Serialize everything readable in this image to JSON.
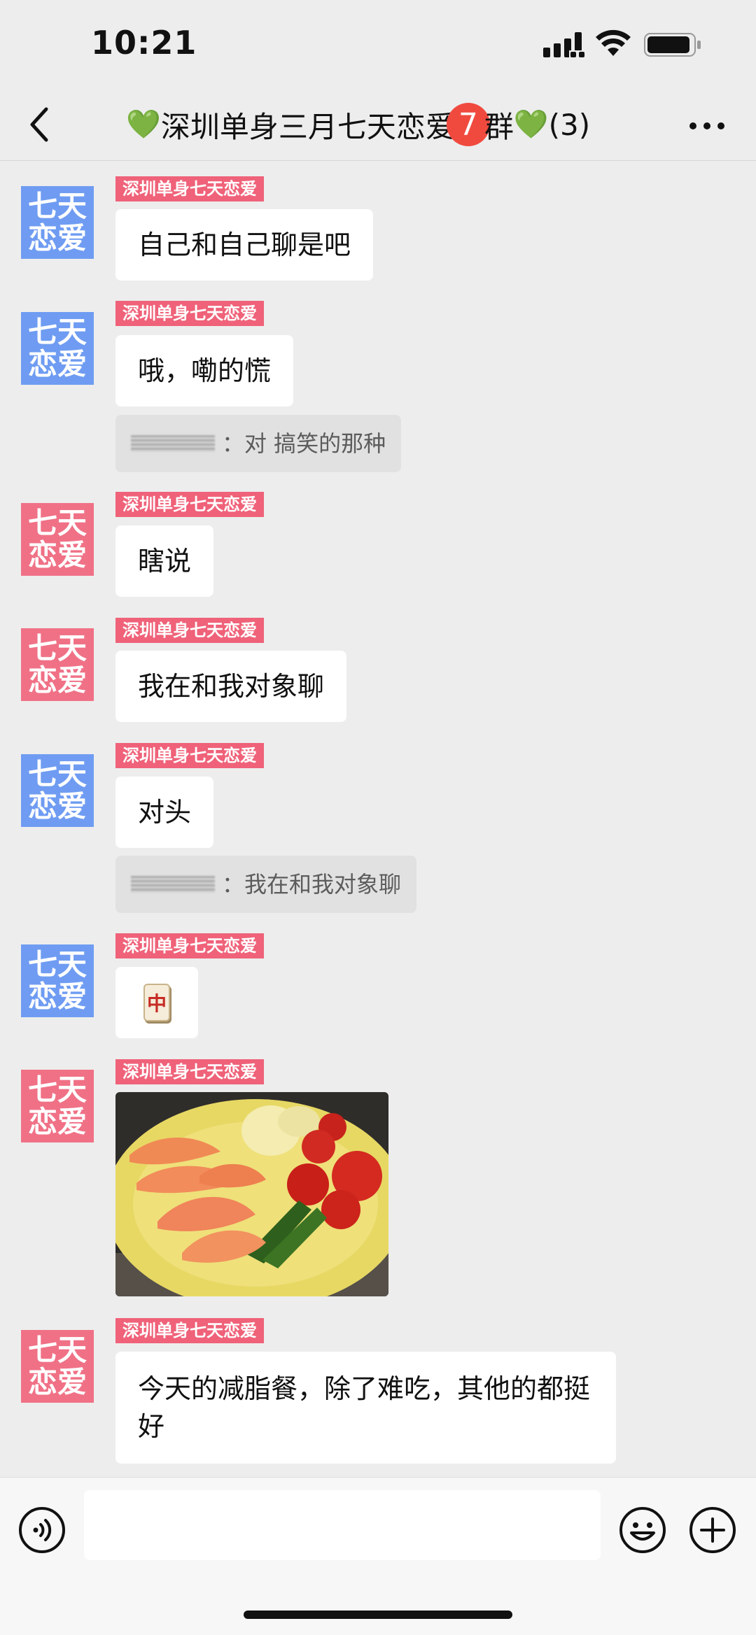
{
  "status_bar": {
    "time": "10:21"
  },
  "nav": {
    "heart_left": "💚",
    "title_text": "深圳单身三月七天恋爱",
    "badge": "7",
    "title_suffix": "群",
    "heart_right": "💚",
    "member_count": "(3)"
  },
  "messages": [
    {
      "avatar_line1": "七天",
      "avatar_line2": "恋爱",
      "sender": "深圳单身七天恋爱",
      "text": "自己和自己聊是吧"
    },
    {
      "avatar_line1": "七天",
      "avatar_line2": "恋爱",
      "sender": "深圳单身七天恋爱",
      "text": "哦，嘞的慌",
      "quote": "：对 搞笑的那种"
    },
    {
      "avatar_line1": "七天",
      "avatar_line2": "恋爱",
      "sender": "深圳单身七天恋爱",
      "text": "瞎说"
    },
    {
      "avatar_line1": "七天",
      "avatar_line2": "恋爱",
      "sender": "深圳单身七天恋爱",
      "text": "我在和我对象聊"
    },
    {
      "avatar_line1": "七天",
      "avatar_line2": "恋爱",
      "sender": "深圳单身七天恋爱",
      "text": "对头",
      "quote": "：我在和我对象聊"
    },
    {
      "avatar_line1": "七天",
      "avatar_line2": "恋爱",
      "sender": "深圳单身七天恋爱",
      "tile": "中"
    },
    {
      "avatar_line1": "七天",
      "avatar_line2": "恋爱",
      "sender": "深圳单身七天恋爱"
    },
    {
      "avatar_line1": "七天",
      "avatar_line2": "恋爱",
      "sender": "深圳单身七天恋爱",
      "text": "今天的减脂餐，除了难吃，其他的都挺好"
    }
  ],
  "colors": {
    "avatar_blue": "#6f9cf2",
    "avatar_red": "#f07186",
    "sender_tag": "#ef6279",
    "badge": "#f04a3f"
  },
  "icons": [
    "back-icon",
    "more-icon",
    "voice-icon",
    "emoji-icon",
    "add-icon",
    "signal-icon",
    "wifi-icon",
    "battery-icon"
  ]
}
